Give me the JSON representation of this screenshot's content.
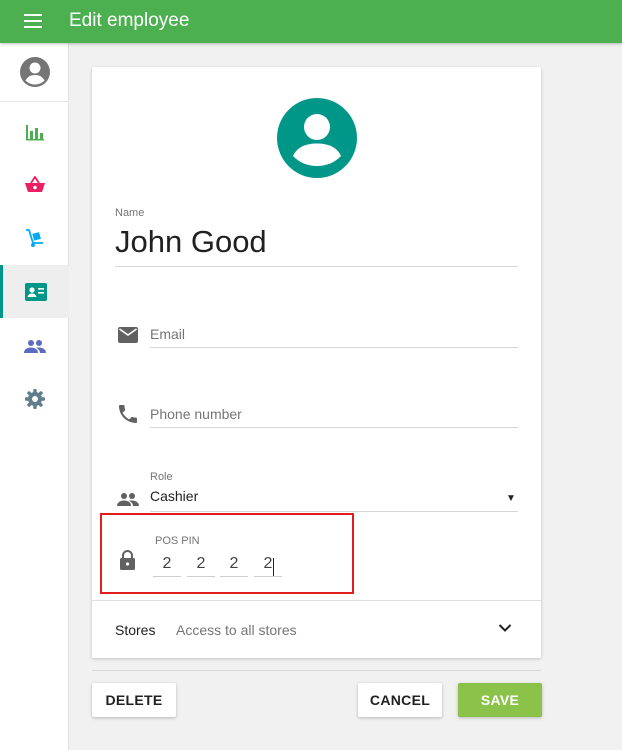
{
  "header": {
    "title": "Edit employee"
  },
  "form": {
    "name_label": "Name",
    "name_value": "John Good",
    "email_placeholder": "Email",
    "phone_placeholder": "Phone number",
    "role_label": "Role",
    "role_value": "Cashier",
    "pin_label": "POS PIN",
    "pin_digits": [
      "2",
      "2",
      "2",
      "2"
    ],
    "stores_label": "Stores",
    "stores_value": "Access to all stores"
  },
  "buttons": {
    "delete": "DELETE",
    "cancel": "CANCEL",
    "save": "SAVE"
  },
  "sidebar": {
    "items": [
      {
        "icon": "bar-chart-icon",
        "color": "#4caf50"
      },
      {
        "icon": "basket-icon",
        "color": "#e91e63"
      },
      {
        "icon": "inventory-icon",
        "color": "#03a9f4"
      },
      {
        "icon": "employee-card-icon",
        "color": "#009688",
        "active": true
      },
      {
        "icon": "customers-icon",
        "color": "#5c6bc0"
      },
      {
        "icon": "settings-icon",
        "color": "#607d8b"
      }
    ]
  },
  "colors": {
    "appbar": "#4caf50",
    "accent": "#009688",
    "save": "#8bc34a",
    "highlight": "#e31c1c"
  }
}
